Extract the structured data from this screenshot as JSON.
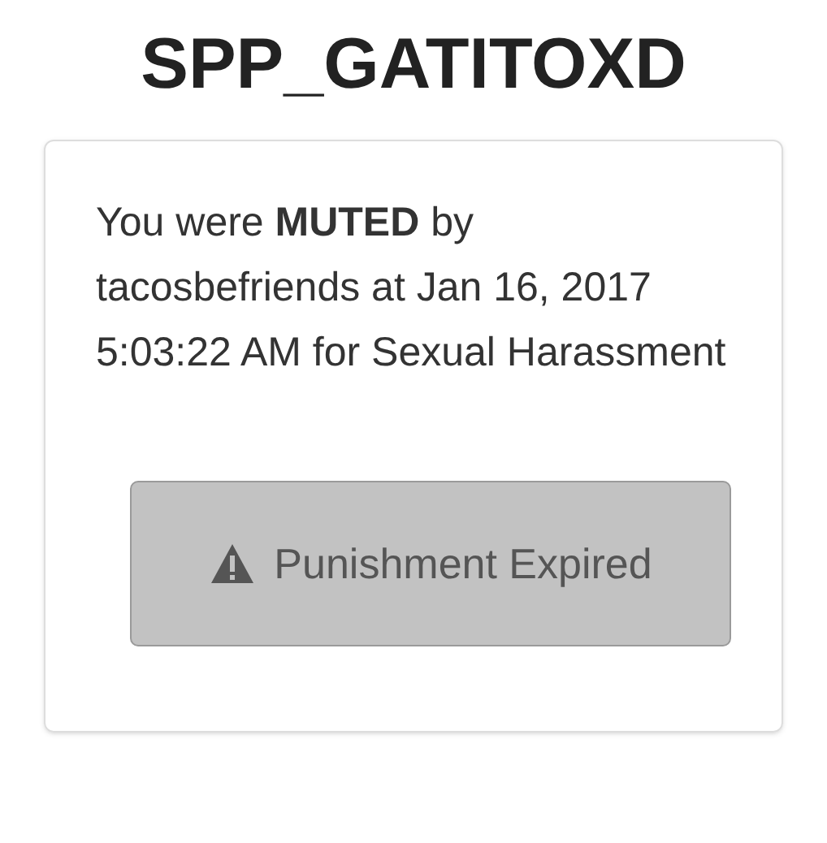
{
  "title": "SPP_GATITOXD",
  "message": "You were **MUTED** by tacosbefriends at Jan 16, 2017 5:03:22 AM for Sexual Harassment",
  "button": {
    "label": "Punishment Expired",
    "disabled": true
  }
}
